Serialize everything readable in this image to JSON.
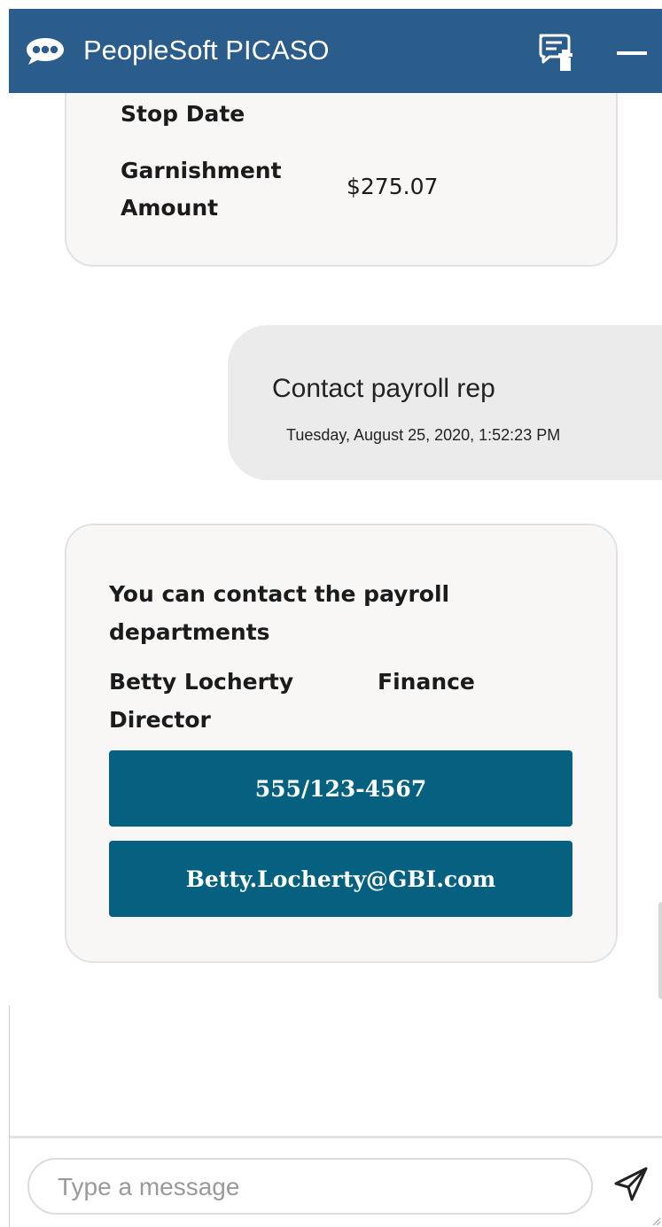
{
  "header": {
    "title": "PeopleSoft PICASO",
    "logo_icon": "chat-bubble-dots-icon",
    "clear_icon": "clear-conversation-icon",
    "minimize_icon": "minimize-icon",
    "bg_color": "#2b5d8c"
  },
  "garnishment_card": {
    "stop_date_label": "Stop Date",
    "amount_label": "Garnishment Amount",
    "amount_value": "$275.07"
  },
  "user_message": {
    "text": "Contact payroll rep",
    "timestamp": "Tuesday, August 25, 2020, 1:52:23 PM"
  },
  "contact_card": {
    "heading": "You can contact the payroll departments",
    "contact_name_title": "Betty Locherty Director",
    "department": "Finance",
    "phone_button": "555/123-4567",
    "email_button": "Betty.Locherty@GBI.com",
    "button_color": "#05617f"
  },
  "composer": {
    "placeholder": "Type a message",
    "send_icon": "send-icon"
  }
}
